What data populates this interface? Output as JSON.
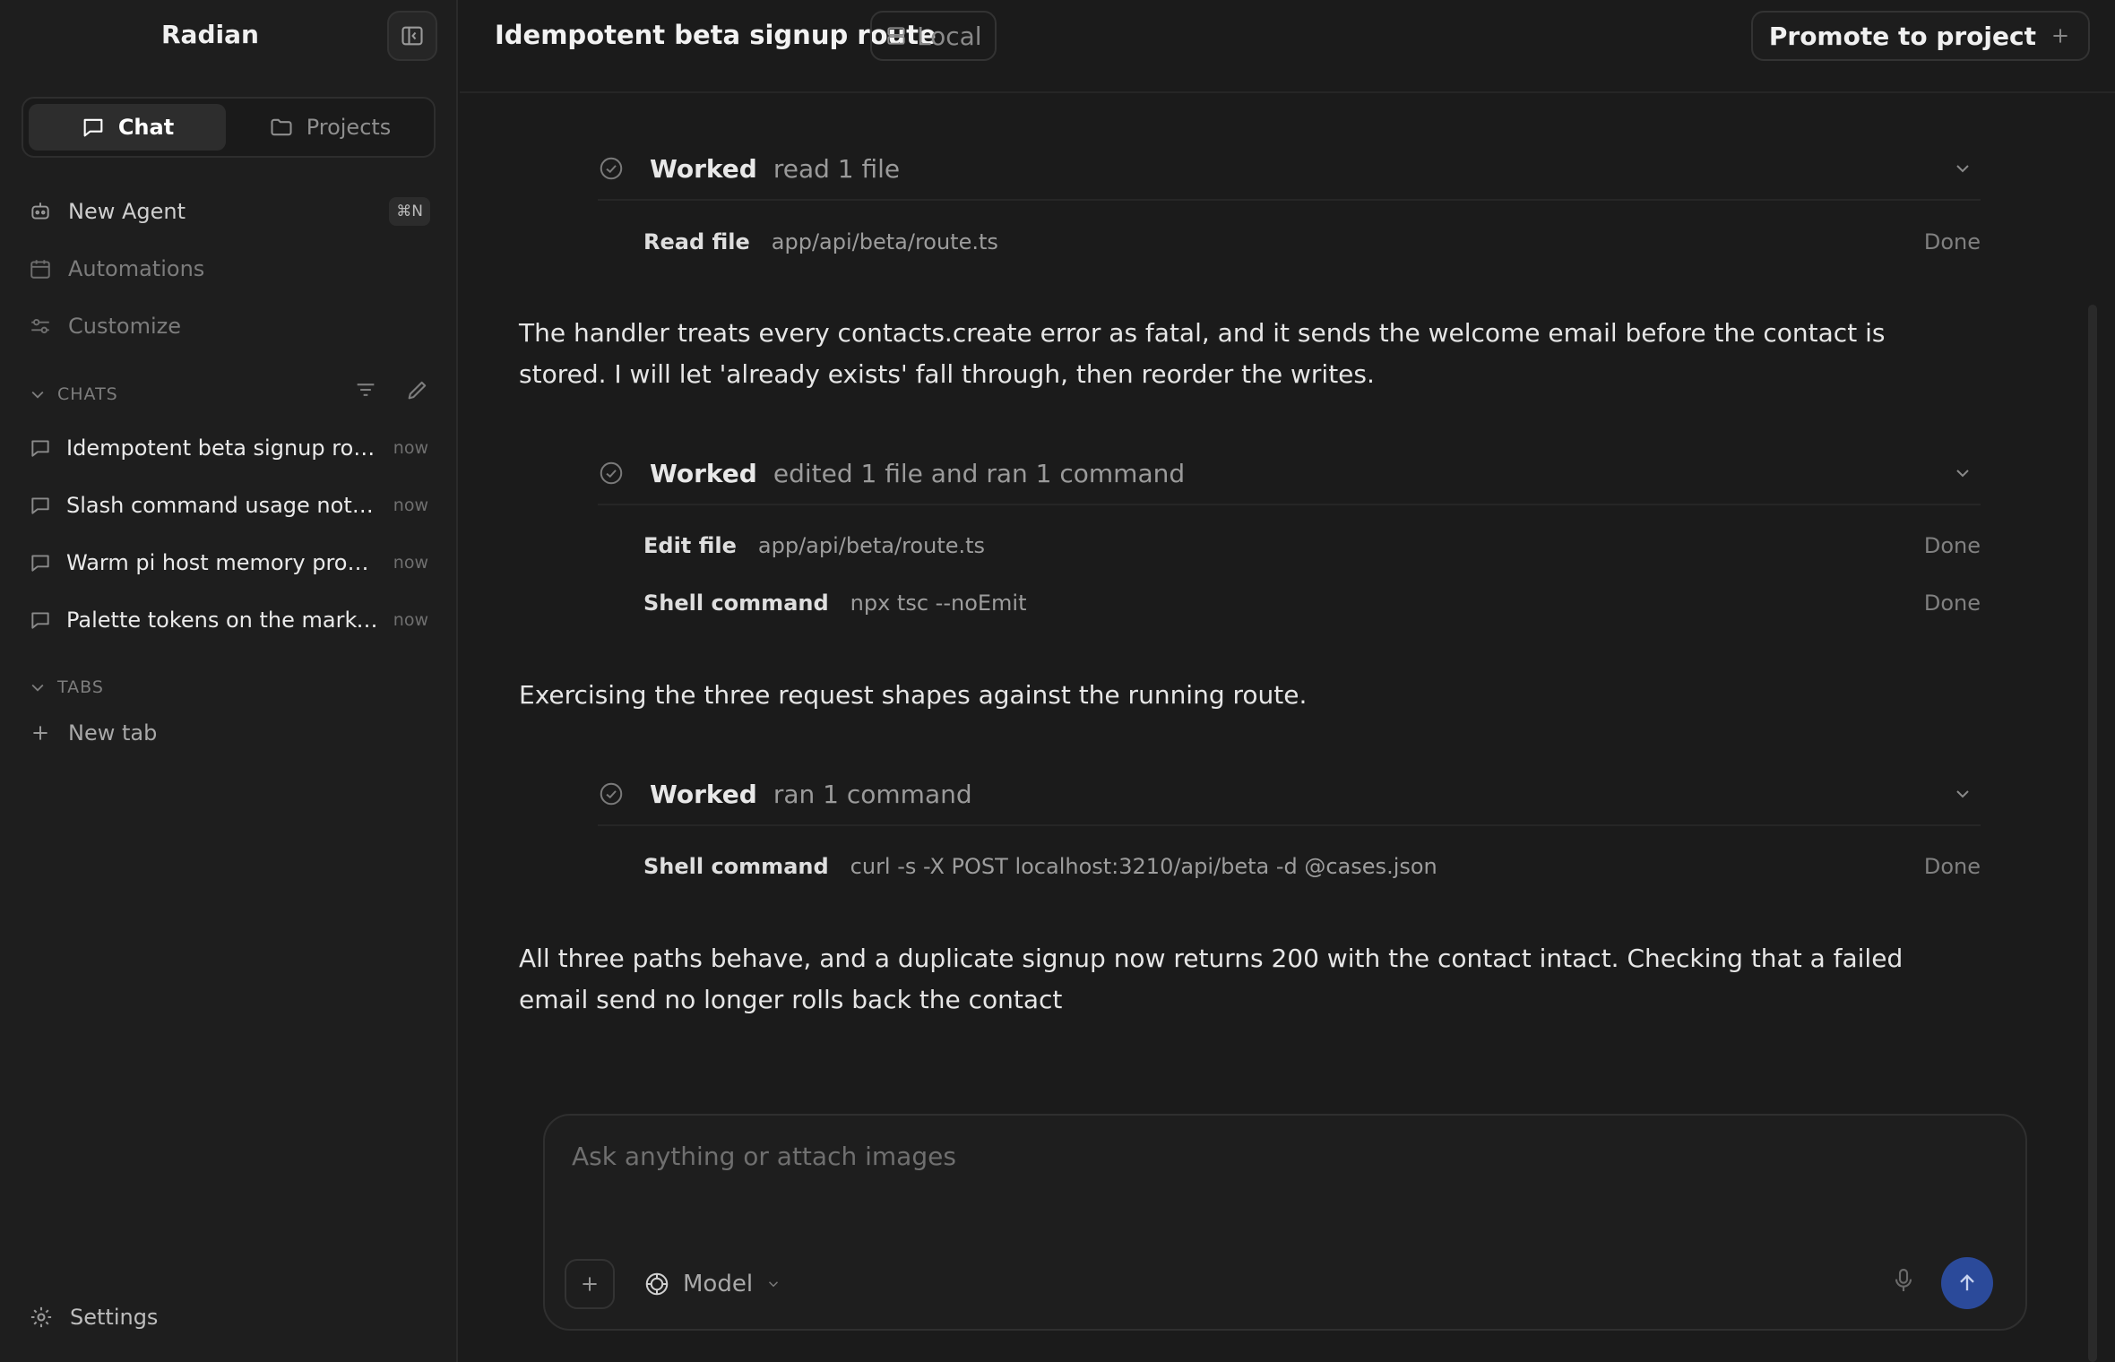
{
  "app": {
    "name": "Radian"
  },
  "sidebar": {
    "segments": {
      "chat": "Chat",
      "projects": "Projects"
    },
    "nav": [
      {
        "label": "New Agent",
        "shortcut": "⌘N"
      },
      {
        "label": "Automations"
      },
      {
        "label": "Customize"
      }
    ],
    "chats_heading": "CHATS",
    "chats": [
      {
        "label": "Idempotent beta signup route",
        "time": "now"
      },
      {
        "label": "Slash command usage notices",
        "time": "now"
      },
      {
        "label": "Warm pi host memory profile",
        "time": "now"
      },
      {
        "label": "Palette tokens on the marketing page",
        "time": "now"
      }
    ],
    "tabs_heading": "TABS",
    "new_tab": "New tab",
    "settings": "Settings"
  },
  "header": {
    "title": "Idempotent beta signup route",
    "env_badge": "Local",
    "promote": "Promote to project"
  },
  "conversation": {
    "groups": [
      {
        "label": "Worked",
        "detail": "read 1 file",
        "steps": [
          {
            "kind": "Read file",
            "arg": "app/api/beta/route.ts",
            "status": "Done"
          }
        ]
      },
      {
        "label": "Worked",
        "detail": "edited 1 file and ran 1 command",
        "steps": [
          {
            "kind": "Edit file",
            "arg": "app/api/beta/route.ts",
            "status": "Done"
          },
          {
            "kind": "Shell command",
            "arg": "npx tsc --noEmit",
            "status": "Done"
          }
        ]
      },
      {
        "label": "Worked",
        "detail": "ran 1 command",
        "steps": [
          {
            "kind": "Shell command",
            "arg": "curl -s -X POST localhost:3210/api/beta -d @cases.json",
            "status": "Done"
          }
        ]
      }
    ],
    "messages": [
      "The handler treats every contacts.create error as fatal, and it sends the welcome email before the contact is stored. I will let 'already exists' fall through, then reorder the writes.",
      "Exercising the three request shapes against the running route.",
      "All three paths behave, and a duplicate signup now returns 200 with the contact intact. Checking that a failed email send no longer rolls back the contact"
    ]
  },
  "composer": {
    "placeholder": "Ask anything or attach images",
    "model_label": "Model"
  }
}
